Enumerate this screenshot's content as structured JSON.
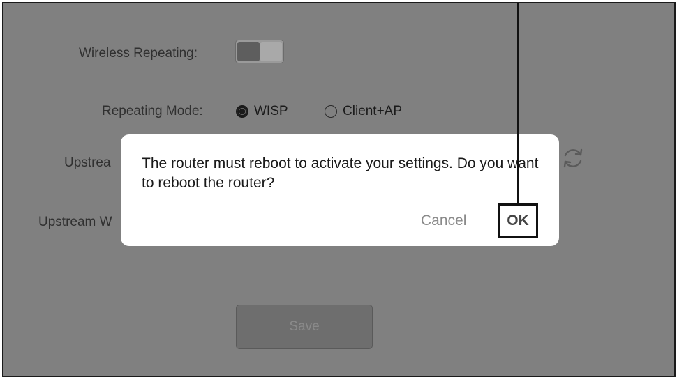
{
  "settings": {
    "wireless_repeating_label": "Wireless Repeating:",
    "wireless_repeating_on": true,
    "repeating_mode_label": "Repeating Mode:",
    "mode_options": [
      "WISP",
      "Client+AP"
    ],
    "mode_selected": "WISP",
    "upstream_label_partial": "Upstrea",
    "upstream_w_label_partial": "Upstream W",
    "save_label": "Save"
  },
  "dialog": {
    "message": "The router must reboot to activate your settings. Do you want to reboot the router?",
    "cancel_label": "Cancel",
    "ok_label": "OK"
  },
  "icons": {
    "refresh": "refresh-icon"
  },
  "colors": {
    "overlay": "#808080",
    "dialog_bg": "#ffffff",
    "highlight_border": "#111111"
  }
}
